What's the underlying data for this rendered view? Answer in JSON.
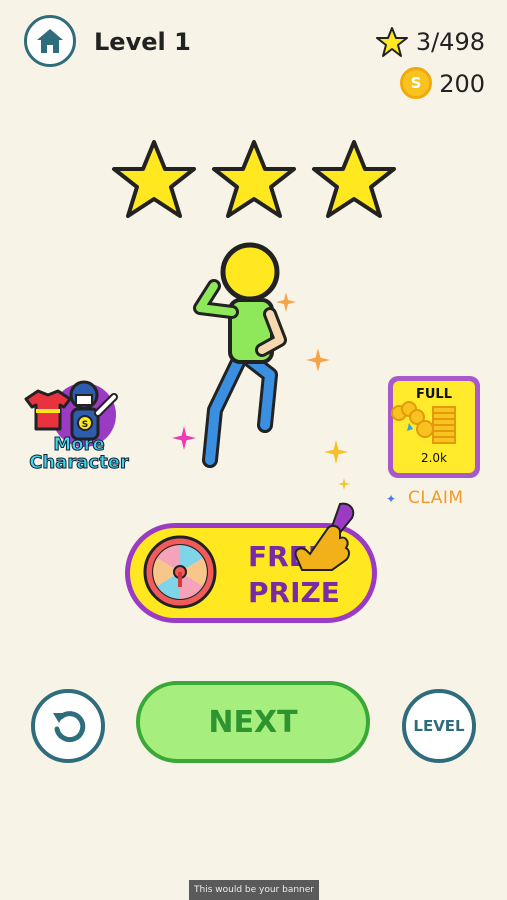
{
  "header": {
    "level_title": "Level 1",
    "stars_count": "3/498",
    "coins_count": "200",
    "coin_symbol": "S"
  },
  "result": {
    "stars_earned": 3,
    "stars_total": 3
  },
  "side_left": {
    "label_line1": "More",
    "label_line2": "Character",
    "badge_letter": "S"
  },
  "side_right": {
    "card_title": "FULL",
    "card_amount": "2.0k",
    "claim_label": "CLAIM"
  },
  "prize_button": {
    "line1": "FREE",
    "line2": "PRIZE"
  },
  "bottom": {
    "next_label": "NEXT",
    "level_label": "LEVEL"
  },
  "banner": {
    "text": "This would be your banner"
  },
  "colors": {
    "background": "#f7f3e6",
    "star_fill": "#ffe81f",
    "accent_teal": "#2f6c7c",
    "purple": "#9b3bc4",
    "next_green": "#a6ee7d"
  }
}
